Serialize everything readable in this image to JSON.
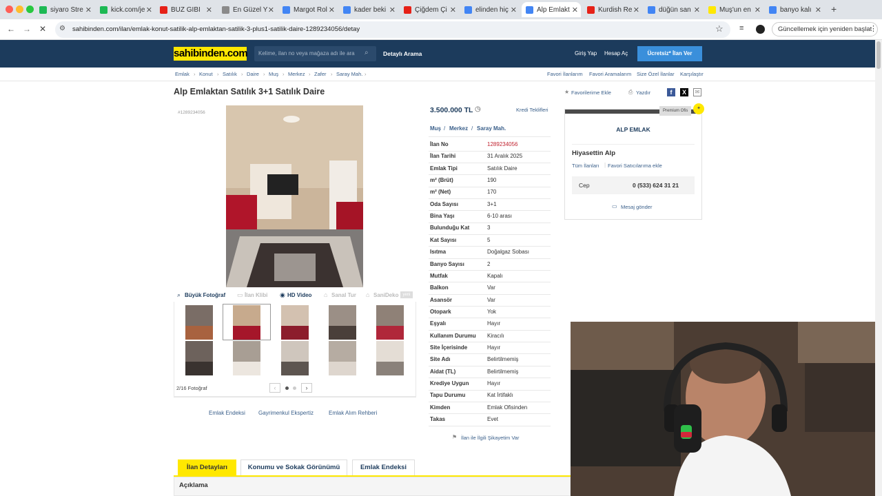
{
  "browser": {
    "tabs": [
      {
        "label": "siyaro Stre",
        "favcolor": "#1db954"
      },
      {
        "label": "kick.com/je",
        "favcolor": "#1db954"
      },
      {
        "label": "BUZ GIBI",
        "favcolor": "#e62117"
      },
      {
        "label": "En Güzel Y",
        "favcolor": "#8a8a8a"
      },
      {
        "label": "Margot Rol",
        "favcolor": "#4285f4"
      },
      {
        "label": "kader beki",
        "favcolor": "#4285f4"
      },
      {
        "label": "Çiğdem Çi",
        "favcolor": "#e62117"
      },
      {
        "label": "elinden hiç",
        "favcolor": "#4285f4"
      },
      {
        "label": "Alp Emlakt",
        "favcolor": "#4285f4"
      },
      {
        "label": "Kurdish Re",
        "favcolor": "#e62117"
      },
      {
        "label": "düğün san",
        "favcolor": "#4285f4"
      },
      {
        "label": "Muş'un en",
        "favcolor": "#ffe800"
      },
      {
        "label": "banyo kalı",
        "favcolor": "#4285f4"
      }
    ],
    "url": "sahibinden.com/ilan/emlak-konut-satilik-alp-emlaktan-satilik-3-plus1-satilik-daire-1289234056/detay",
    "update_label": "Güncellemek için yeniden başlat"
  },
  "header": {
    "logo": "sahibinden.com",
    "search_placeholder": "Kelime, ilan no veya mağaza adı ile ara",
    "detailed_search": "Detaylı Arama",
    "login": "Giriş Yap",
    "register": "Hesap Aç",
    "post_ad": "Ücretsiz* İlan Ver"
  },
  "breadcrumb": [
    "Emlak",
    "Konut",
    "Satılık",
    "Daire",
    "Muş",
    "Merkez",
    "Zafer",
    "Saray Mah."
  ],
  "crumb_links": [
    "Favori İlanlarım",
    "Favori Aramalarım",
    "Size Özel İlanlar",
    "Karşılaştır"
  ],
  "listing": {
    "title": "Alp Emlaktan Satılık 3+1 Satılık Daire",
    "fav_add": "Favorilerime Ekle",
    "print": "Yazdır",
    "id_tag": "#1289234056",
    "price": "3.500.000 TL",
    "credit": "Kredi Teklifleri",
    "location": [
      "Muş",
      "Merkez",
      "Saray Mah."
    ],
    "photo_actions": [
      "Büyük Fotoğraf",
      "İlan Klibi",
      "HD Video",
      "Sanal Tur",
      "SaniDeko"
    ],
    "photo_count": "2/16 Fotoğraf",
    "details": [
      {
        "label": "İlan No",
        "value": "1289234056"
      },
      {
        "label": "İlan Tarihi",
        "value": "31 Aralık 2025"
      },
      {
        "label": "Emlak Tipi",
        "value": "Satılık Daire"
      },
      {
        "label": "m² (Brüt)",
        "value": "190"
      },
      {
        "label": "m² (Net)",
        "value": "170"
      },
      {
        "label": "Oda Sayısı",
        "value": "3+1"
      },
      {
        "label": "Bina Yaşı",
        "value": "6-10 arası"
      },
      {
        "label": "Bulunduğu Kat",
        "value": "3"
      },
      {
        "label": "Kat Sayısı",
        "value": "5"
      },
      {
        "label": "Isıtma",
        "value": "Doğalgaz Sobası"
      },
      {
        "label": "Banyo Sayısı",
        "value": "2"
      },
      {
        "label": "Mutfak",
        "value": "Kapalı"
      },
      {
        "label": "Balkon",
        "value": "Var"
      },
      {
        "label": "Asansör",
        "value": "Var"
      },
      {
        "label": "Otopark",
        "value": "Yok"
      },
      {
        "label": "Eşyalı",
        "value": "Hayır"
      },
      {
        "label": "Kullanım Durumu",
        "value": "Kiracılı"
      },
      {
        "label": "Site İçerisinde",
        "value": "Hayır"
      },
      {
        "label": "Site Adı",
        "value": "Belirtilmemiş"
      },
      {
        "label": "Aidat (TL)",
        "value": "Belirtilmemiş"
      },
      {
        "label": "Krediye Uygun",
        "value": "Hayır"
      },
      {
        "label": "Tapu Durumu",
        "value": "Kat İrtifaklı"
      },
      {
        "label": "Kimden",
        "value": "Emlak Ofisinden"
      },
      {
        "label": "Takas",
        "value": "Evet"
      }
    ],
    "complaint": "İlan ile İlgili Şikayetim Var",
    "below_links": [
      "Emlak Endeksi",
      "Gayrimenkul Ekspertiz",
      "Emlak Alım Rehberi"
    ]
  },
  "seller": {
    "premium": "Premium Ofis",
    "office": "ALP EMLAK",
    "name": "Hiyasettin Alp",
    "all_ads": "Tüm İlanları",
    "fav_seller": "Favori Satıcılarıma ekle",
    "phone_label": "Cep",
    "phone": "0 (533) 624 31 21",
    "message": "Mesaj gönder"
  },
  "bottom_tabs": [
    "İlan Detayları",
    "Konumu ve Sokak Görünümü",
    "Emlak Endeksi"
  ],
  "description_header": "Açıklama"
}
